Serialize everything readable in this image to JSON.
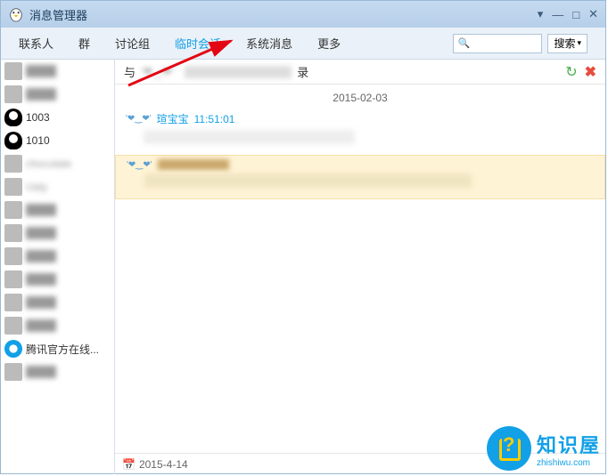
{
  "titlebar": {
    "title": "消息管理器"
  },
  "tabs": {
    "items": [
      "联系人",
      "群",
      "讨论组",
      "临时会话",
      "系统消息",
      "更多"
    ],
    "active_index": 3
  },
  "search": {
    "placeholder": "",
    "button": "搜索",
    "icon": "🔍"
  },
  "sidebar": {
    "items": [
      {
        "name": "",
        "blur": true,
        "avatar": "plain"
      },
      {
        "name": "",
        "blur": true,
        "avatar": "plain"
      },
      {
        "name": "1003",
        "blur": false,
        "avatar": "penguin"
      },
      {
        "name": "1010",
        "blur": false,
        "avatar": "penguin"
      },
      {
        "name": "chocolate",
        "blur": true,
        "avatar": "plain"
      },
      {
        "name": "Ualy",
        "blur": true,
        "avatar": "plain"
      },
      {
        "name": "",
        "blur": true,
        "avatar": "plain"
      },
      {
        "name": "",
        "blur": true,
        "avatar": "plain"
      },
      {
        "name": "",
        "blur": true,
        "avatar": "plain"
      },
      {
        "name": "",
        "blur": true,
        "avatar": "plain"
      },
      {
        "name": "",
        "blur": true,
        "avatar": "plain"
      },
      {
        "name": "",
        "blur": true,
        "avatar": "plain"
      },
      {
        "name": "腾讯官方在线...",
        "blur": false,
        "avatar": "q"
      },
      {
        "name": "",
        "blur": true,
        "avatar": "plain"
      }
    ]
  },
  "chat": {
    "header_prefix": "与",
    "header_mid": "'❤‿❤'",
    "header_suffix": "录",
    "date": "2015-02-03",
    "messages": [
      {
        "name": "瑄宝宝",
        "time": "11:51:01",
        "highlight": false
      },
      {
        "name": "",
        "time": "",
        "highlight": true
      }
    ],
    "footer_date": "2015-4-14"
  },
  "watermark": {
    "main": "知识屋",
    "sub": "zhishiwu.com"
  }
}
